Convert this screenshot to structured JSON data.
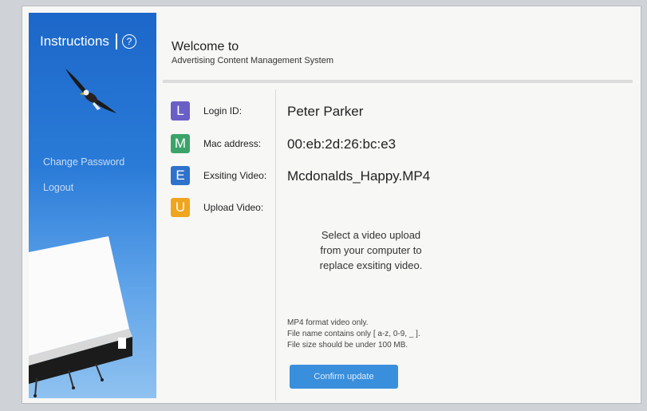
{
  "sidebar": {
    "instructions_label": "Instructions",
    "help_icon": "?",
    "links": [
      "Change Password",
      "Logout"
    ]
  },
  "header": {
    "title": "Welcome to",
    "subtitle": "Advertising Content Management System"
  },
  "fields": [
    {
      "letter": "L",
      "label": "Login ID:",
      "value": "Peter Parker",
      "color": "#6a5fc7"
    },
    {
      "letter": "M",
      "label": "Mac address:",
      "value": "00:eb:2d:26:bc:e3",
      "color": "#3ba36a"
    },
    {
      "letter": "E",
      "label": "Exsiting Video:",
      "value": "Mcdonalds_Happy.MP4",
      "color": "#2f72cc"
    },
    {
      "letter": "U",
      "label": "Upload Video:",
      "value": "",
      "color": "#f0a51e"
    }
  ],
  "upload": {
    "prompt_lines": [
      "Select a video upload",
      "from your computer to",
      "replace exsiting video."
    ]
  },
  "notes": [
    "MP4 format video only.",
    "File name contains only [ a-z, 0-9, _ ].",
    "File size should be under 100 MB."
  ],
  "confirm_button": "Confirm update"
}
